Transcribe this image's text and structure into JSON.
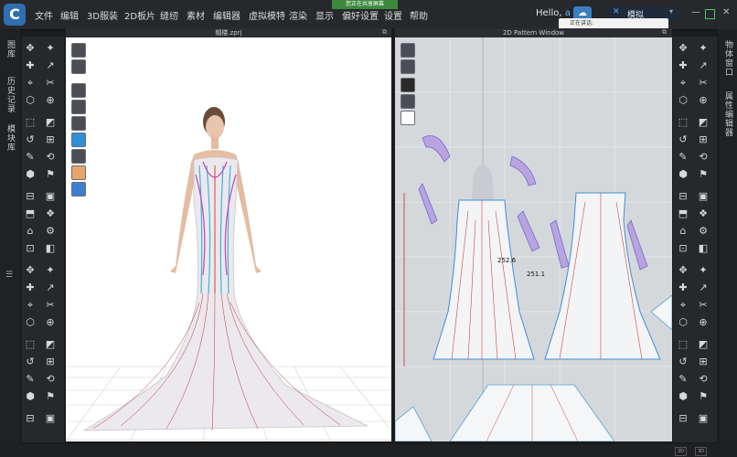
{
  "menubar": {
    "items": [
      "文件",
      "编辑",
      "3D服装",
      "2D板片",
      "缝纫",
      "素材",
      "编辑器",
      "虚拟模特",
      "渲染",
      "显示",
      "偏好设置",
      "设置",
      "帮助"
    ],
    "share_banner": "您正在共享屏幕",
    "greeting": "Hello,",
    "username": "a",
    "workspace": "模拟",
    "talking": "正在讲话:"
  },
  "side_tabs_left": [
    "图库",
    "历史记录",
    "模块库"
  ],
  "side_tabs_right": [
    "物体窗口",
    "属性编辑器"
  ],
  "windows": {
    "v3d_title": "帽楼.zprj",
    "v2d_title": "2D Pattern Window"
  },
  "pattern_dims": {
    "d1": "252.6",
    "d2": "251.1"
  },
  "statusbar": {
    "badge1": "2D",
    "badge2": "3D"
  },
  "colors": {
    "accent": "#2f6fb0",
    "menubar": "#26282b",
    "viewport3d": "#ffffff",
    "viewport2d": "#d5d8db"
  }
}
